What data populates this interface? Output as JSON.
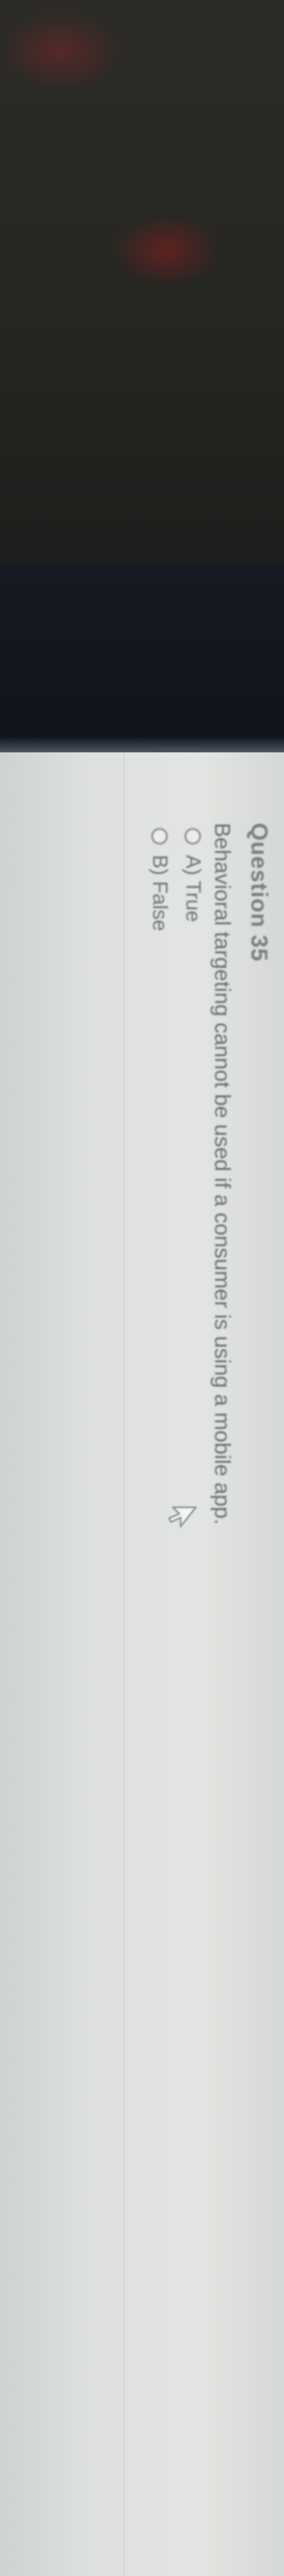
{
  "question": {
    "header": "Question 35",
    "text": "Behavioral targeting cannot be used if a consumer is using a mobile app.",
    "options": [
      {
        "label": "A) True"
      },
      {
        "label": "B) False"
      }
    ],
    "selected": null
  },
  "icons": {
    "cursor": "mouse-pointer-icon"
  },
  "colors": {
    "screen_background": "#dde0dd",
    "text": "#6a6f75",
    "radio_border": "#8e9297"
  }
}
